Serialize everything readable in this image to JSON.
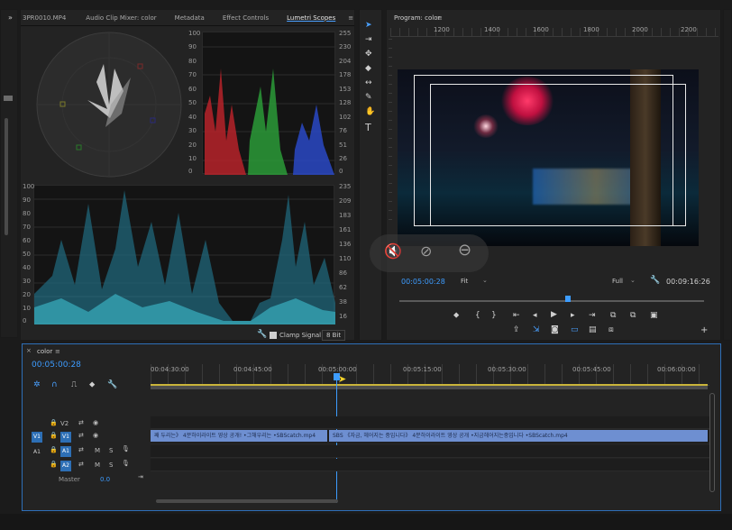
{
  "left_edge": {
    "tab_chevron": "»"
  },
  "source_panel": {
    "tabs": [
      "3PR0010.MP4",
      "Audio Clip Mixer: color",
      "Metadata",
      "Effect Controls",
      "Lumetri Scopes"
    ],
    "active_tab": "Lumetri Scopes",
    "menu_icon": "≡",
    "parade_left_ticks": [
      "100",
      "90",
      "80",
      "70",
      "60",
      "50",
      "40",
      "30",
      "20",
      "10",
      "0"
    ],
    "parade_right_ticks": [
      "255",
      "230",
      "204",
      "178",
      "153",
      "128",
      "102",
      "76",
      "51",
      "26",
      "0"
    ],
    "waveform_left_ticks": [
      "100",
      "90",
      "80",
      "70",
      "60",
      "50",
      "40",
      "30",
      "20",
      "10",
      "0"
    ],
    "waveform_right_ticks": [
      "235",
      "209",
      "183",
      "161",
      "136",
      "110",
      "86",
      "62",
      "38",
      "16"
    ],
    "clamp_signal_label": "Clamp Signal",
    "bit_depth": "8 Bit"
  },
  "tools": {
    "items": [
      "selection-tool",
      "track-select-tool",
      "ripple-edit-tool",
      "razor-tool",
      "slip-tool",
      "pen-tool",
      "hand-tool",
      "type-tool"
    ]
  },
  "program_monitor": {
    "title": "Program: color",
    "menu_icon": "≡",
    "ruler_labels": [
      "1200",
      "1400",
      "1600",
      "1800",
      "2000",
      "2200"
    ],
    "timecode": "00:05:00:28",
    "fit": "Fit",
    "quality": "Full",
    "duration": "00:09:16:26"
  },
  "overlay": {
    "buttons": [
      "mute-icon",
      "audio-off-icon",
      "minus-circle-icon"
    ]
  },
  "timeline": {
    "title": "color",
    "menu_icon": "≡",
    "timecode": "00:05:00:28",
    "ruler": [
      "00:04:30:00",
      "00:04:45:00",
      "00:05:00:00",
      "00:05:15:00",
      "00:05:30:00",
      "00:05:45:00",
      "00:06:00:00"
    ],
    "tracks": {
      "v2": "V2",
      "v1": "V1",
      "a1": "A1",
      "a2": "A2",
      "master": "Master",
      "master_value": "0.0",
      "src_v1": "V1",
      "src_a1": "A1",
      "m": "M",
      "s": "S"
    },
    "clips": {
      "clip1": "째 두리는》 4분하이라이트 영상 공개! •그해우리는 •SBScatch.mp4",
      "clip2": "SBS 《자금, 헤어지는 중입니다》 4분하이라이트 영상 공개 •지금헤어지는중입니다 •SBScatch.mp4"
    }
  }
}
